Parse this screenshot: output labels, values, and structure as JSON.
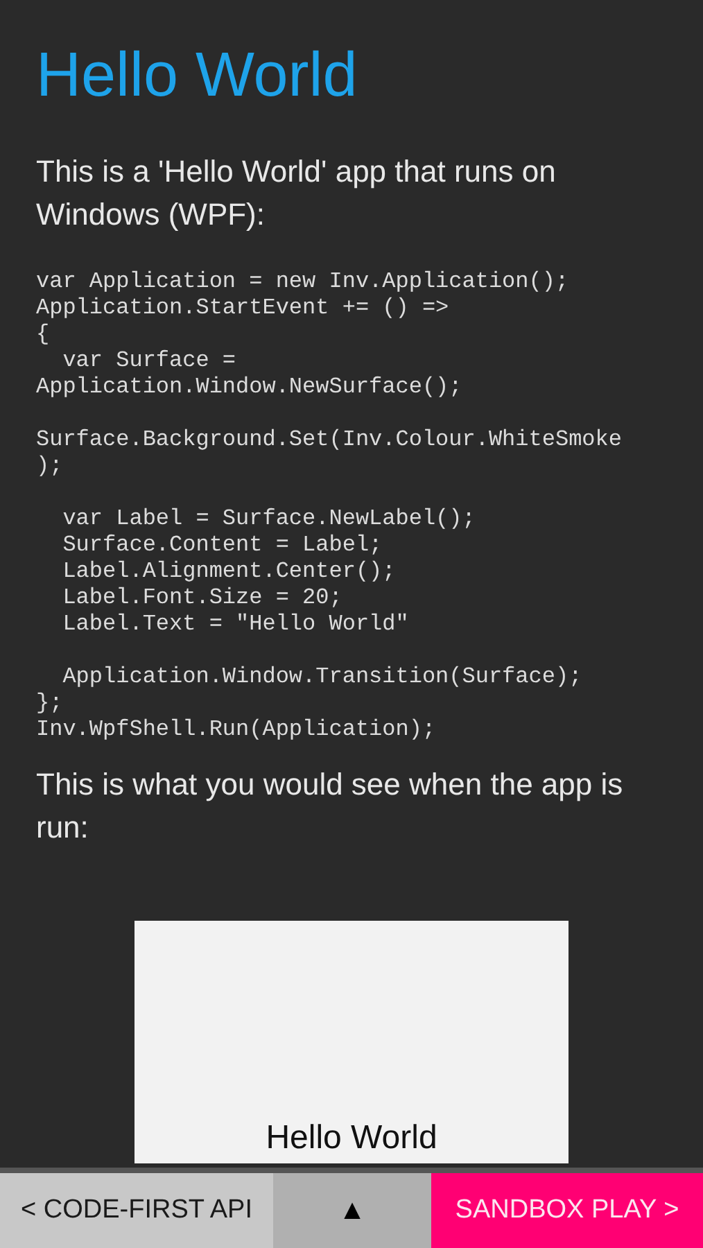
{
  "title": "Hello World",
  "intro": "This is a 'Hello World' app that runs on Windows (WPF):",
  "code": "var Application = new Inv.Application();\nApplication.StartEvent += () =>\n{\n  var Surface =\nApplication.Window.NewSurface();\n\nSurface.Background.Set(Inv.Colour.WhiteSmoke\n);\n\n  var Label = Surface.NewLabel();\n  Surface.Content = Label;\n  Label.Alignment.Center();\n  Label.Font.Size = 20;\n  Label.Text = \"Hello World\"\n\n  Application.Window.Transition(Surface);\n};\nInv.WpfShell.Run(Application);",
  "result_caption": "This is what you would see when the app is run:",
  "preview": {
    "label": "Hello World"
  },
  "nav": [
    {
      "kind": "back",
      "label": "< CODE-FIRST API"
    },
    {
      "kind": "top",
      "label": "▲"
    },
    {
      "kind": "next",
      "label": "SANDBOX PLAY >"
    }
  ]
}
